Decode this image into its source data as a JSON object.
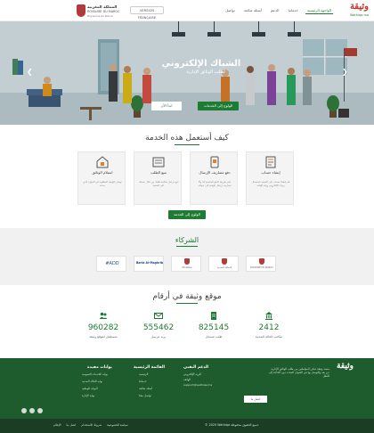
{
  "header": {
    "brand": "وثيقة",
    "brand_sub": "Wathiqa.ma",
    "nav": [
      "الواجهة الرئيسية",
      "خدماتنا",
      "الدعم",
      "أسئلة شائعة",
      "تواصل"
    ],
    "lang_button": "VERSION FRANÇAISE",
    "gov_line1": "المملكة المغربية",
    "gov_line2": "ROYAUME DU MAROC",
    "gov_line3": "Royaume du Maroc"
  },
  "hero": {
    "title": "الشباك الإلكتروني",
    "subtitle": "لطلب الوثائق الإدارية",
    "btn_services": "الولوج إلى الخدمات",
    "btn_start": "ابدأ الآن",
    "slides": 3,
    "active_slide": 2
  },
  "how": {
    "title": "كيف أستعمل هذه الخدمة",
    "cards": [
      {
        "title": "إنشاء حساب",
        "desc": "قم بإنشاء حساب على المنصة باستعمال بريدك الإلكتروني ورقم الهاتف",
        "icon": "form-icon"
      },
      {
        "title": "دفع مصاريف الإرسال",
        "desc": "اختر طريقة الدفع المناسبة لك وأدِّ مصاريف إرسال الوثيقة إلى عنوانك",
        "icon": "payment-icon"
      },
      {
        "title": "تتبع الطلب",
        "desc": "تتبع مراحل معالجة طلبك من خلال حسابك على المنصة",
        "icon": "tracking-icon"
      },
      {
        "title": "استلام الوثائق",
        "desc": "توصل بالوثيقة المطلوبة في العنوان الذي حددته",
        "icon": "delivery-icon"
      }
    ],
    "btn_access": "الولوج إلى الخدمة"
  },
  "partners": {
    "title": "الشركاء",
    "items": [
      {
        "name": "المملكة المغربية",
        "sub": "ROYAUME DU MAROC"
      },
      {
        "name": "المملكة المغربية",
        "sub": "Ministère"
      },
      {
        "name": "المملكة المغربية",
        "sub": "Ministère"
      },
      {
        "name": "Barid Al-Maghrib",
        "sub": ""
      },
      {
        "name": "#ADD",
        "sub": ""
      }
    ]
  },
  "stats": {
    "title": "موقع وثيقة في أرقام",
    "items": [
      {
        "value": "2412",
        "label": "مكاتب الحالة المدنية",
        "icon": "building-icon"
      },
      {
        "value": "825145",
        "label": "طلب مسجل",
        "icon": "document-icon"
      },
      {
        "value": "555462",
        "label": "بريد مرسل",
        "icon": "mail-icon"
      },
      {
        "value": "960282",
        "label": "مستعمل لموقع وثيقة",
        "icon": "users-icon"
      }
    ]
  },
  "footer": {
    "about": "منصة وثيقة تمكن المواطنين من طلب الوثائق الإدارية عن بعد والتوصل بها في العنوان المحدد دون الحاجة إلى التنقل",
    "contact_btn": "اتصل بنا",
    "support_title": "الدعم التقني",
    "support_lines": [
      "البريد الإلكتروني",
      "الهاتف",
      "support@wathiqa.ma"
    ],
    "quick_title": "القائمة الرئيسية",
    "quick_items": [
      "الرئيسية",
      "خدماتنا",
      "أسئلة شائعة",
      "تواصل معنا"
    ],
    "portal_title": "بوابات مفيدة",
    "portal_items": [
      "بوابة الخدمات العمومية",
      "بوابة الحالة المدنية",
      "البوابة الوطنية",
      "بوابة الإدارة"
    ],
    "copyright": "© 2020 Wathiqa جميع الحقوق محفوظة",
    "sub_links": [
      "سياسة الخصوصية",
      "شروط الاستخدام",
      "اتصل بنا",
      "الإعلام"
    ]
  },
  "colors": {
    "primary": "#1e7b34",
    "footer": "#1e5b2d",
    "subfooter": "#1b3d24"
  }
}
